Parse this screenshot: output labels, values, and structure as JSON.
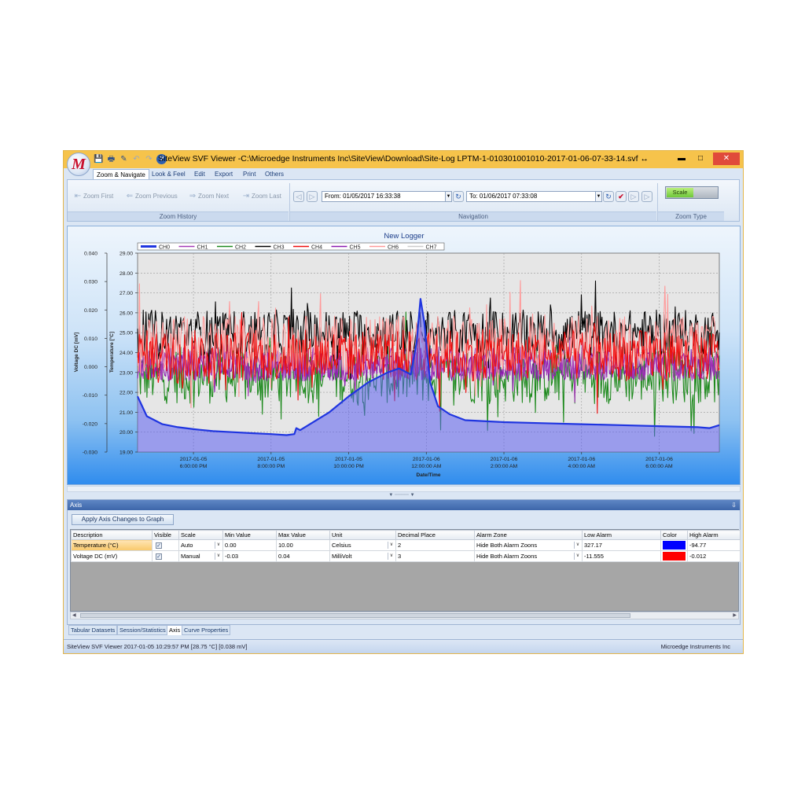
{
  "window": {
    "title": "SiteView SVF Viewer -C:\\Microedge Instruments Inc\\SiteView\\Download\\Site-Log LPTM-1-010301001010-2017-01-06-07-33-14.svf",
    "logo_letter": "M",
    "resize_glyph": "↔",
    "minimize": "▬",
    "maximize": "□",
    "close": "✕"
  },
  "quick_access": {
    "save": "💾",
    "print": "🖶",
    "edit": "✎",
    "undo": "↶",
    "redo": "↷",
    "help": "?"
  },
  "tabs": [
    "Zoom & Navigate",
    "Look & Feel",
    "Edit",
    "Export",
    "Print",
    "Others"
  ],
  "ribbon": {
    "zoom_first": "Zoom First",
    "zoom_previous": "Zoom Previous",
    "zoom_next": "Zoom Next",
    "zoom_last": "Zoom Last",
    "zoom_history_label": "Zoom History",
    "from_value": "From: 01/05/2017 16:33:38",
    "to_value": "To: 01/06/2017 07:33:08",
    "navigation_label": "Navigation",
    "scale_label": "Scale",
    "zoom_type_label": "Zoom Type"
  },
  "chart_data": {
    "type": "line",
    "title": "New Logger",
    "xlabel": "Date/Time",
    "ylabel_left_outer": "Voltage DC [mV]",
    "ylabel_left_inner": "Temperature [°C]",
    "y_temp_ticks": [
      "29.00",
      "28.00",
      "27.00",
      "26.00",
      "25.00",
      "24.00",
      "23.00",
      "22.00",
      "21.00",
      "20.00",
      "19.00"
    ],
    "y_temp_range": [
      19,
      29
    ],
    "y_volt_ticks": [
      "0.040",
      "0.030",
      "0.020",
      "0.010",
      "0.000",
      "-0.010",
      "-0.020",
      "-0.030"
    ],
    "y_volt_range": [
      -0.03,
      0.04
    ],
    "x_ticks": [
      {
        "date": "2017-01-05",
        "time": "6:00:00 PM"
      },
      {
        "date": "2017-01-05",
        "time": "8:00:00 PM"
      },
      {
        "date": "2017-01-05",
        "time": "10:00:00 PM"
      },
      {
        "date": "2017-01-06",
        "time": "12:00:00 AM"
      },
      {
        "date": "2017-01-06",
        "time": "2:00:00 AM"
      },
      {
        "date": "2017-01-06",
        "time": "4:00:00 AM"
      },
      {
        "date": "2017-01-06",
        "time": "6:00:00 AM"
      }
    ],
    "x_range_hours": [
      16.56,
      31.55
    ],
    "grid": true,
    "legend_position": "top",
    "series": [
      {
        "name": "CH0",
        "color": "#1f35e0",
        "axis": "temperature",
        "points": [
          [
            16.56,
            21.8
          ],
          [
            16.8,
            20.8
          ],
          [
            17.2,
            20.4
          ],
          [
            17.6,
            20.25
          ],
          [
            18.0,
            20.15
          ],
          [
            18.5,
            20.05
          ],
          [
            19.0,
            20.0
          ],
          [
            19.5,
            19.95
          ],
          [
            20.0,
            19.9
          ],
          [
            20.4,
            19.85
          ],
          [
            20.6,
            19.9
          ],
          [
            20.65,
            20.2
          ],
          [
            20.75,
            20.1
          ],
          [
            21.0,
            20.4
          ],
          [
            21.5,
            21.0
          ],
          [
            22.0,
            21.8
          ],
          [
            22.5,
            22.5
          ],
          [
            23.0,
            23.0
          ],
          [
            23.3,
            23.2
          ],
          [
            23.5,
            23.0
          ],
          [
            23.6,
            22.9
          ],
          [
            23.75,
            24.5
          ],
          [
            23.85,
            26.7
          ],
          [
            23.95,
            25.5
          ],
          [
            24.1,
            22.5
          ],
          [
            24.3,
            21.3
          ],
          [
            24.6,
            20.9
          ],
          [
            25.0,
            20.6
          ],
          [
            26.0,
            20.5
          ],
          [
            27.0,
            20.45
          ],
          [
            28.0,
            20.4
          ],
          [
            29.0,
            20.35
          ],
          [
            30.0,
            20.3
          ],
          [
            31.0,
            20.25
          ],
          [
            31.3,
            20.2
          ],
          [
            31.55,
            20.35
          ]
        ]
      },
      {
        "name": "CH1",
        "color": "#a63ab8",
        "axis": "voltage",
        "center": 0.001,
        "spread": 0.006
      },
      {
        "name": "CH2",
        "color": "#1e8a1e",
        "axis": "voltage",
        "center": -0.003,
        "spread": 0.01
      },
      {
        "name": "CH3",
        "color": "#000000",
        "axis": "voltage",
        "center": 0.012,
        "spread": 0.008
      },
      {
        "name": "CH4",
        "color": "#ee1010",
        "axis": "voltage",
        "center": 0.004,
        "spread": 0.009
      },
      {
        "name": "CH5",
        "color": "#8c1bb0",
        "axis": "voltage",
        "center": 0.0,
        "spread": 0.005
      },
      {
        "name": "CH6",
        "color": "#ff9a9a",
        "axis": "voltage",
        "center": 0.008,
        "spread": 0.01
      },
      {
        "name": "CH7",
        "color": "#ffffff",
        "axis": "voltage",
        "center": 0.0,
        "spread": 0.0
      }
    ]
  },
  "axis_panel": {
    "header": "Axis",
    "pin": "⇩",
    "apply_button": "Apply Axis Changes to Graph",
    "columns": [
      "Description",
      "Visible",
      "Scale",
      "Min Value",
      "Max Value",
      "Unit",
      "Decimal Place",
      "Alarm Zone",
      "Low Alarm",
      "Color",
      "High Alarm"
    ],
    "rows": [
      {
        "description": "Temperature (°C)",
        "visible": "✓",
        "scale": "Auto",
        "min": "0.00",
        "max": "10.00",
        "unit": "Celsius",
        "decimals": "2",
        "alarm_zone": "Hide Both Alarm Zoons",
        "low_alarm": "327.17",
        "color": "#0000ff",
        "high_alarm": "-94.77"
      },
      {
        "description": "Voltage DC (mV)",
        "visible": "✓",
        "scale": "Manual",
        "min": "-0.03",
        "max": "0.04",
        "unit": "MilliVolt",
        "decimals": "3",
        "alarm_zone": "Hide Both Alarm Zoons",
        "low_alarm": "-11.555",
        "color": "#ff0000",
        "high_alarm": "-0.012"
      }
    ],
    "dropdown_glyph": "∨"
  },
  "bottom_tabs": [
    "Tabular Datasets",
    "Session/Statistics",
    "Axis",
    "Curve Properties"
  ],
  "status": {
    "left": "SiteView SVF Viewer   2017-01-05 10:29:57 PM [28.75 °C]  [0.038 mV]",
    "right": "Microedge Instruments Inc"
  }
}
